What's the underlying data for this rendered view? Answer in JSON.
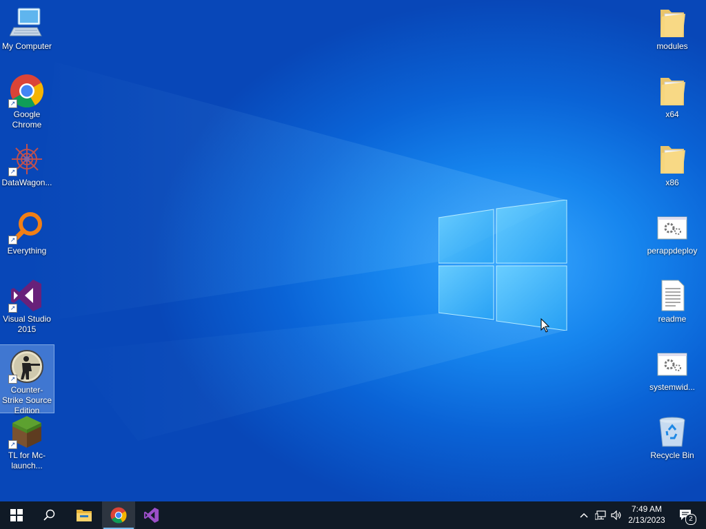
{
  "desktop": {
    "left_icons": [
      {
        "label": "My Computer",
        "icon": "computer-icon"
      },
      {
        "label": "Google Chrome",
        "icon": "chrome-icon"
      },
      {
        "label": "DataWagon...",
        "icon": "datawagon-icon"
      },
      {
        "label": "Everything",
        "icon": "everything-search-icon"
      },
      {
        "label": "Visual Studio 2015",
        "icon": "visual-studio-icon"
      },
      {
        "label": "Counter-Strike Source Edition",
        "icon": "counter-strike-icon"
      },
      {
        "label": "TL for Mc-launch...",
        "icon": "minecraft-grass-block-icon"
      }
    ],
    "right_icons": [
      {
        "label": "modules",
        "icon": "folder-icon"
      },
      {
        "label": "x64",
        "icon": "folder-icon"
      },
      {
        "label": "x86",
        "icon": "folder-icon"
      },
      {
        "label": "perappdeploy",
        "icon": "settings-file-icon"
      },
      {
        "label": "readme",
        "icon": "text-file-icon"
      },
      {
        "label": "systemwid...",
        "icon": "settings-file-icon"
      },
      {
        "label": "Recycle Bin",
        "icon": "recycle-bin-icon"
      }
    ]
  },
  "taskbar": {
    "buttons": [
      "start-icon",
      "search-icon",
      "file-explorer-icon",
      "chrome-icon",
      "visual-studio-icon"
    ],
    "active_app": "Google Chrome",
    "tray": [
      "chevron-up-icon",
      "network-icon",
      "volume-icon"
    ],
    "clock": {
      "time": "7:49 AM",
      "date": "2/13/2023"
    },
    "notifications": {
      "icon": "action-center-icon",
      "count": "2"
    }
  },
  "colors": {
    "taskbar_bg": "#101a26",
    "accent": "#76b9ed",
    "wallpaper": "#0a63d6"
  }
}
